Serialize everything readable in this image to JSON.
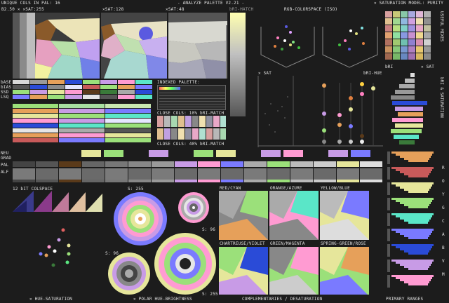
{
  "header": {
    "unique_cols": "UNIQUE COLS IN PAL: 16",
    "title": "- ANALYZE PALETTE V2.21 -",
    "saturation_model": "✕ SATURATION MODEL: PURITY"
  },
  "hue_panel": {
    "brightness_label": "B2.50 ✕ ✕SAT:255",
    "sat128": "✕SAT:128",
    "sat48": "✕SAT:48"
  },
  "rgb_panel": {
    "bri_hatch": "bRI-HATCH",
    "title": "RGB-COLORSPACE (ISO)",
    "sat_label": "✕ SAT",
    "bri_hue": "bRI-HUE"
  },
  "mid_panel": {
    "indexed_palette": "INDEXED PALETTE:",
    "close_cols_10": "CLOSE COLS: 10% bRI-MATCH",
    "close_cols_40": "CLOSE COLS: 40% bRI-MATCH",
    "row_labels": [
      "bASE",
      "bIAS",
      "SSD",
      "LSQ"
    ]
  },
  "right_panel": {
    "useful_mixes": "USEFUL MIXES",
    "bri_saturation": "bRI & SATURATION",
    "bri": "bRI",
    "sat": "✕ SAT",
    "spectrum_letters": [
      "R",
      "O",
      "Y",
      "G",
      "C",
      "A",
      "B",
      "V",
      "M"
    ],
    "primary_ranges": "PRIMARY RANGES"
  },
  "strip": {
    "labels": [
      "NEU",
      "GRAD",
      "PAL",
      "ALF"
    ]
  },
  "bottom": {
    "colspace_12bit": "12 bIT COLSPACE",
    "s255_a": "S: 255",
    "s96_a": "S: 96",
    "s96_b": "S: 96",
    "s255_b": "S: 255",
    "pairs": [
      "RED/CYAN",
      "ORANGE/AZURE",
      "YELLOW/BLUE",
      "CHARTREUSE/VIOLET",
      "GREEN/MAGENTA",
      "SPRING-GREEN/ROSE"
    ],
    "footer_hue_sat": "✕ HUE-SATURATION",
    "footer_polar": "✕ POLAR HUE-BRIGHTNESS",
    "footer_comp": "COMPLEMENTARIES / DESATURATION",
    "footer_primary": "PRIMARY RANGES"
  },
  "palette": [
    "#000000",
    "#575757",
    "#a0a0a0",
    "#ffffff",
    "#2a4bd7",
    "#1d6914",
    "#814a19",
    "#8126c0",
    "#9dafff",
    "#81c57a",
    "#e9debb",
    "#ad2323",
    "#29d0d0",
    "#ffee33",
    "#ff9233",
    "#ffcdf3"
  ],
  "pal_colors": [
    "#e6e6e6",
    "#9a9a9a",
    "#6e6e6e",
    "#f2c7c7",
    "#e6a05a",
    "#9be07a",
    "#7aa0e6",
    "#c89be6",
    "#e6e69b",
    "#5ae6c8",
    "#7a7aff",
    "#ff9bd2",
    "#5a3a1a",
    "#3a7a3a",
    "#c85a5a",
    "#e6e6ff"
  ]
}
